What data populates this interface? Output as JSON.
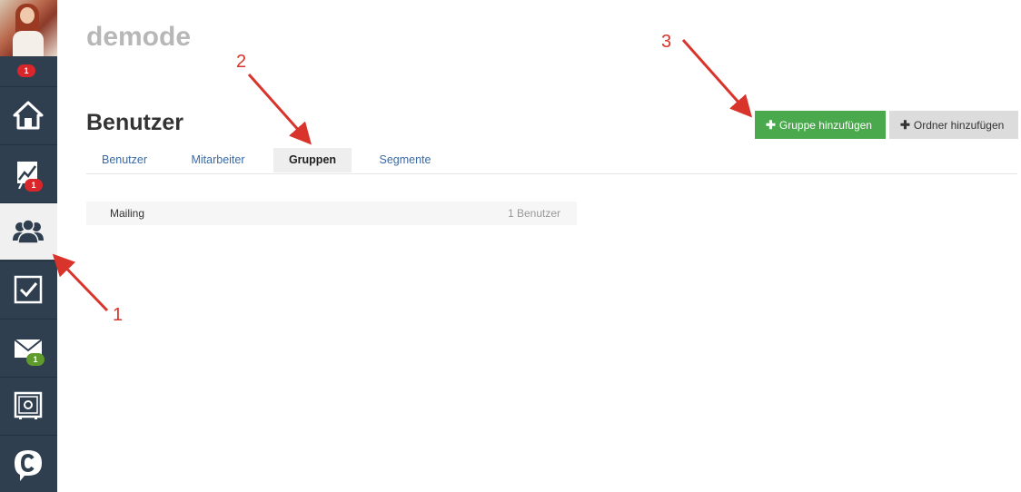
{
  "sidebar": {
    "avatar_badge": "1",
    "items": [
      {
        "name": "home",
        "icon": "home-icon",
        "badge": ""
      },
      {
        "name": "statistics",
        "icon": "chart-icon",
        "badge": "1"
      },
      {
        "name": "users",
        "icon": "users-icon",
        "badge": "",
        "active": true
      },
      {
        "name": "tasks",
        "icon": "checkbox-icon",
        "badge": ""
      },
      {
        "name": "mail",
        "icon": "envelope-icon",
        "badge": "1"
      },
      {
        "name": "settings",
        "icon": "safe-icon",
        "badge": ""
      },
      {
        "name": "chat",
        "icon": "chat-icon",
        "badge": ""
      }
    ]
  },
  "header": {
    "brand": "demode",
    "title": "Benutzer"
  },
  "actions": {
    "add_group": "Gruppe hinzufügen",
    "add_folder": "Ordner hinzufügen"
  },
  "tabs": [
    {
      "label": "Benutzer"
    },
    {
      "label": "Mitarbeiter"
    },
    {
      "label": "Gruppen",
      "active": true
    },
    {
      "label": "Segmente"
    }
  ],
  "groups": [
    {
      "name": "Mailing",
      "count": "1 Benutzer"
    }
  ],
  "annotations": {
    "one": "1",
    "two": "2",
    "three": "3"
  },
  "colors": {
    "sidebar": "#2f3f50",
    "accent_green": "#4aa84d",
    "annotation_red": "#d9342b",
    "link_blue": "#3a6aa5"
  }
}
